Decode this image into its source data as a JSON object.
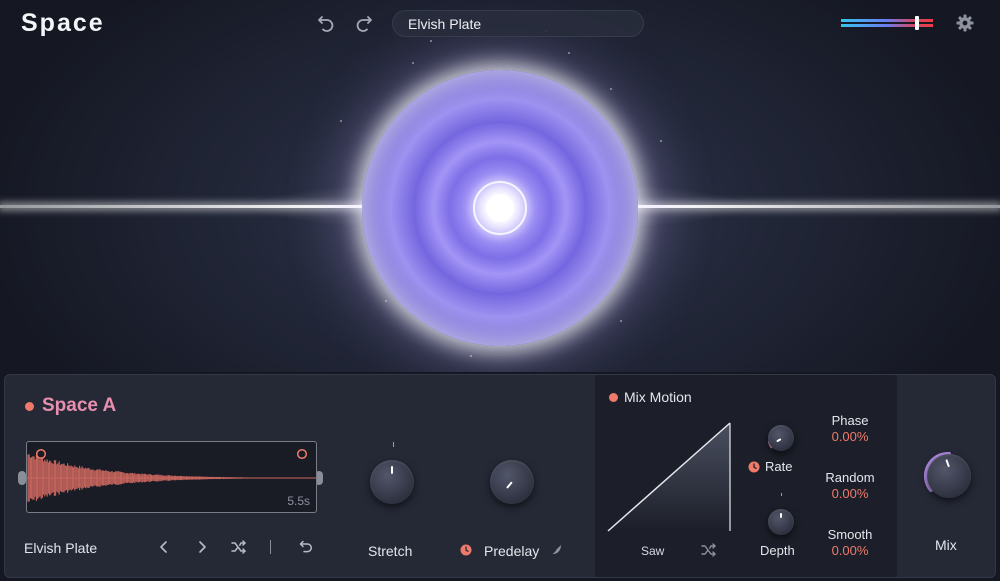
{
  "app": {
    "title": "Space"
  },
  "header": {
    "preset_name": "Elvish Plate"
  },
  "module": {
    "title": "Space A",
    "enabled": true,
    "ir_name": "Elvish Plate",
    "ir_length": "5.5s",
    "knobs": {
      "stretch": {
        "label": "Stretch"
      },
      "predelay": {
        "label": "Predelay"
      }
    }
  },
  "mix_motion": {
    "title": "Mix Motion",
    "enabled": true,
    "shape": "Saw",
    "rate_label": "Rate",
    "depth_label": "Depth",
    "phase": {
      "label": "Phase",
      "value": "0.00%"
    },
    "random": {
      "label": "Random",
      "value": "0.00%"
    },
    "smooth": {
      "label": "Smooth",
      "value": "0.00%"
    }
  },
  "mix": {
    "label": "Mix"
  },
  "colors": {
    "accent": "#ef7a6a",
    "title_pink": "#e88faf",
    "panel": "#252936",
    "waveform": "#c9675e"
  },
  "icons": [
    "undo-icon",
    "redo-icon",
    "gear-icon",
    "chevron-left-icon",
    "chevron-right-icon",
    "shuffle-icon",
    "undo-icon",
    "clock-icon",
    "feather-icon"
  ]
}
